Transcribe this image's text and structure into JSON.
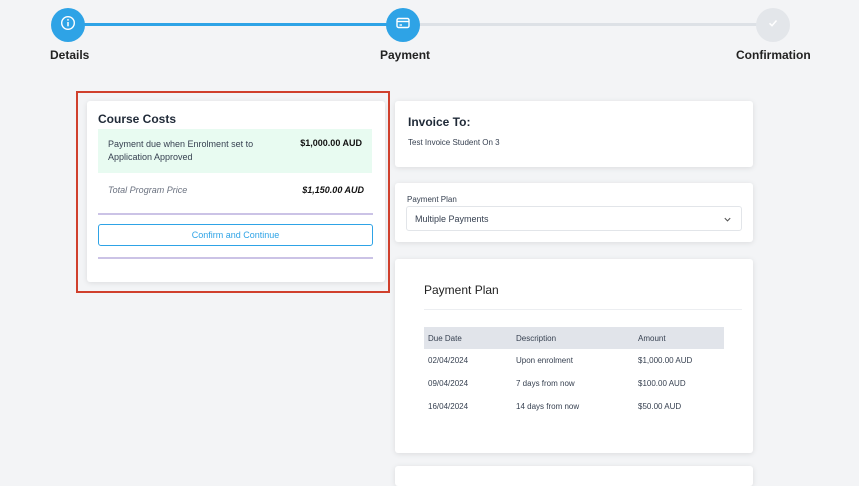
{
  "stepper": {
    "steps": [
      {
        "label": "Details",
        "state": "completed",
        "icon": "info-icon"
      },
      {
        "label": "Payment",
        "state": "active",
        "icon": "credit-card-icon"
      },
      {
        "label": "Confirmation",
        "state": "pending",
        "icon": "check-icon"
      }
    ],
    "active_color": "#2ea3e6",
    "inactive_color": "#e3e6ea"
  },
  "course_costs": {
    "title": "Course Costs",
    "due_text": "Payment due when Enrolment set to Application Approved",
    "due_amount": "$1,000.00 AUD",
    "total_label": "Total Program Price",
    "total_amount": "$1,150.00 AUD",
    "confirm_button": "Confirm and Continue",
    "highlight_color": "#d0402d"
  },
  "invoice": {
    "title": "Invoice To:",
    "name": "Test Invoice Student On 3"
  },
  "payment_plan_select": {
    "label": "Payment Plan",
    "value": "Multiple Payments",
    "icon": "chevron-down-icon"
  },
  "plan_table": {
    "title": "Payment Plan",
    "headers": [
      "Due Date",
      "Description",
      "Amount"
    ],
    "rows": [
      [
        "02/04/2024",
        "Upon enrolment",
        "$1,000.00 AUD"
      ],
      [
        "09/04/2024",
        "7 days from now",
        "$100.00 AUD"
      ],
      [
        "16/04/2024",
        "14 days from now",
        "$50.00 AUD"
      ]
    ]
  }
}
